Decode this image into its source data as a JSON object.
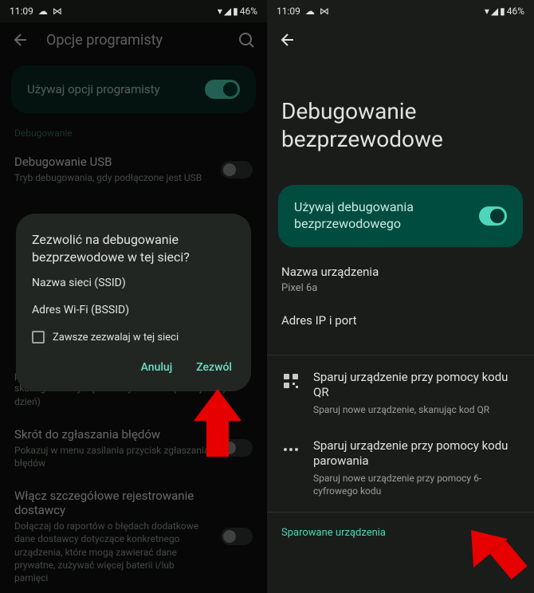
{
  "status": {
    "time": "11:09",
    "battery": "46%"
  },
  "left": {
    "header_title": "Opcje programisty",
    "toggle_label": "Używaj opcji programisty",
    "section_debug": "Debugowanie",
    "usb_title": "Debugowanie USB",
    "usb_sub": "Tryb debugowania, gdy podłączone jest USB",
    "tail_sub": "połączy się ponownie w czasie domyślnym (7 dni) lub skonfigurowanym przez użytkownika (co najmniej 1 dzień)",
    "shortcut_title": "Skrót do zgłaszania błędów",
    "shortcut_sub": "Pokazuj w menu zasilania przycisk zgłaszania błędów",
    "verbose_title": "Włącz szczegółowe rejestrowanie dostawcy",
    "verbose_sub": "Dołączaj do raportów o błędach dodatkowe dane dostawcy dotyczące konkretnego urządzenia, które mogą zawierać dane prywatne, zużywać więcej baterii i/lub pamięci"
  },
  "dialog": {
    "title": "Zezwolić na debugowanie bezprzewodowe w tej sieci?",
    "ssid_label": "Nazwa sieci (SSID)",
    "bssid_label": "Adres Wi-Fi (BSSID)",
    "always": "Zawsze zezwalaj w tej sieci",
    "cancel": "Anuluj",
    "allow": "Zezwól"
  },
  "right": {
    "title": "Debugowanie bezprzewodowe",
    "toggle_label": "Używaj debugowania bezprzewodowego",
    "device_label": "Nazwa urządzenia",
    "device_value": "Pixel 6a",
    "ip_label": "Adres IP i port",
    "qr_title": "Sparuj urządzenie przy pomocy kodu QR",
    "qr_sub": "Sparuj nowe urządzenie, skanując kod QR",
    "code_title": "Sparuj urządzenie przy pomocy kodu parowania",
    "code_sub": "Sparuj nowe urządzenie przy pomocy 6-cyfrowego kodu",
    "paired": "Sparowane urządzenia"
  }
}
